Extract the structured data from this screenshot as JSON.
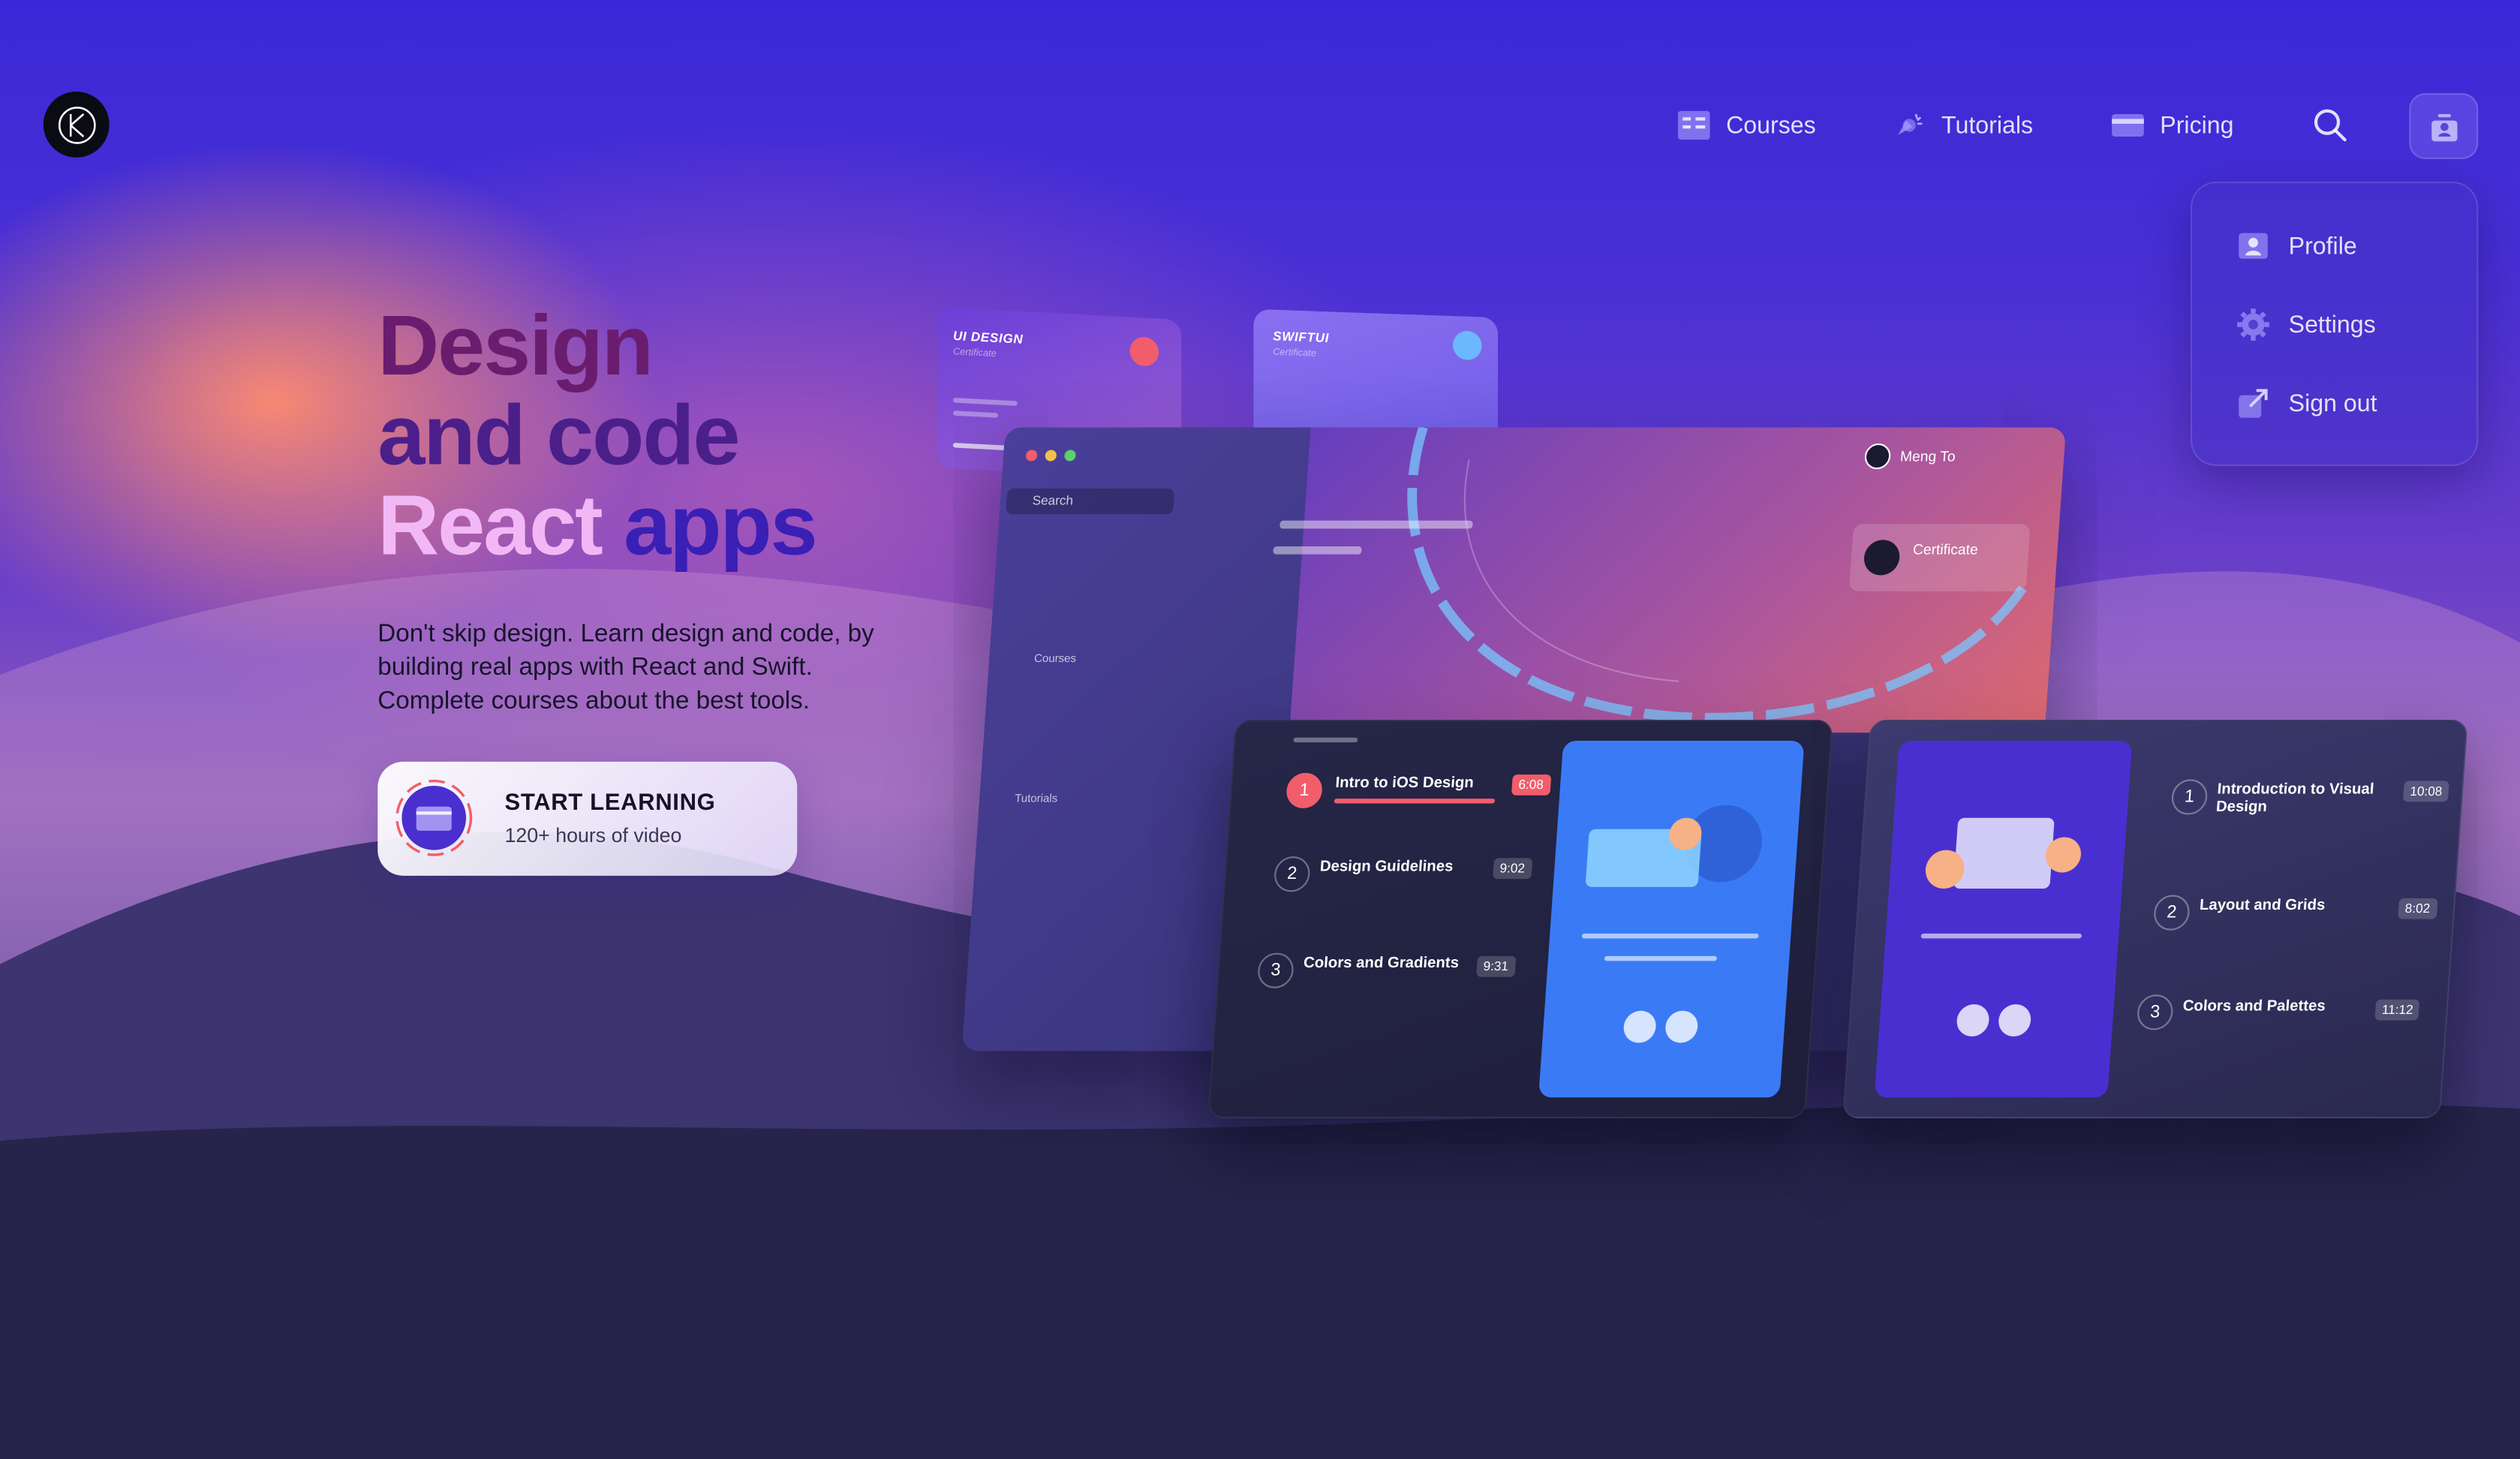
{
  "nav": {
    "courses": "Courses",
    "tutorials": "Tutorials",
    "pricing": "Pricing"
  },
  "menu": {
    "profile": "Profile",
    "settings": "Settings",
    "sign_out": "Sign out"
  },
  "hero": {
    "title_line1": "Design",
    "title_line2": "and code",
    "title_line3a": "React",
    "title_line3b": "apps",
    "description": "Don't skip design. Learn design and code, by building real apps with React and Swift. Complete courses about the best tools.",
    "cta_title": "START LEARNING",
    "cta_subtitle": "120+ hours of video"
  },
  "mockup": {
    "cert_ui_title": "UI DESIGN",
    "cert_ui_sub": "Certificate",
    "cert_swift_title": "SWIFTUI",
    "cert_swift_sub": "Certificate",
    "search_placeholder": "Search",
    "sidebar_courses": "Courses",
    "sidebar_tutorials": "Tutorials",
    "user_name": "Meng To",
    "certificate_label": "Certificate",
    "left_list": [
      {
        "num": "1",
        "title": "Intro to iOS Design",
        "time": "6:08"
      },
      {
        "num": "2",
        "title": "Design Guidelines",
        "time": "9:02"
      },
      {
        "num": "3",
        "title": "Colors and Gradients",
        "time": "9:31"
      }
    ],
    "right_list": [
      {
        "num": "1",
        "title": "Introduction to Visual Design",
        "time": "10:08"
      },
      {
        "num": "2",
        "title": "Layout and Grids",
        "time": "8:02"
      },
      {
        "num": "3",
        "title": "Colors and Palettes",
        "time": "11:12"
      }
    ]
  },
  "colors": {
    "accent_red": "#f25d6b",
    "accent_blue": "#3a7bf5",
    "accent_indigo": "#4a2fd0"
  }
}
